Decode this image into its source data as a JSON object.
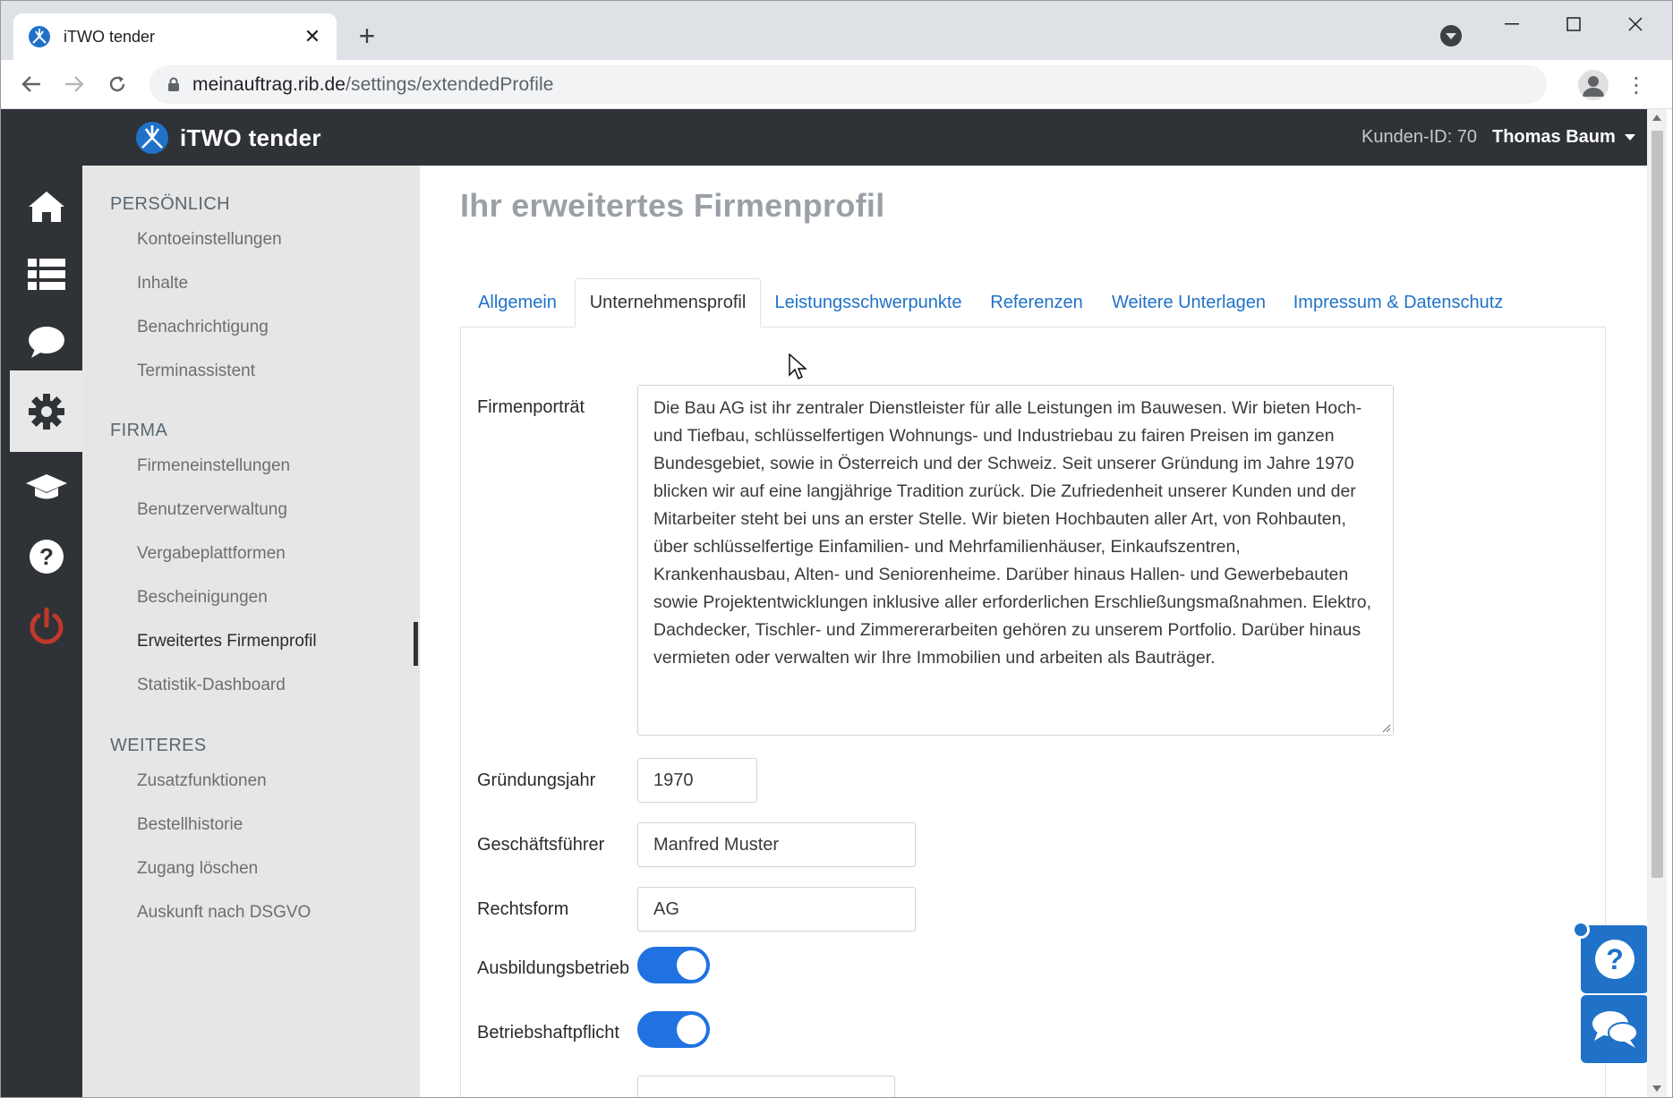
{
  "browser": {
    "tab_title": "iTWO tender",
    "url_host": "meinauftrag.rib.de",
    "url_path": "/settings/extendedProfile"
  },
  "appbar": {
    "logo_text": "iTWO tender",
    "customer_id": "Kunden-ID: 70",
    "user_name": "Thomas Baum"
  },
  "iconrail": [
    {
      "icon": "home-icon"
    },
    {
      "icon": "list-icon"
    },
    {
      "icon": "chat-bubble-icon"
    },
    {
      "icon": "gear-icon",
      "active": true
    },
    {
      "icon": "graduation-cap-icon"
    },
    {
      "icon": "question-circle-icon"
    },
    {
      "icon": "power-icon"
    }
  ],
  "sidenav": {
    "section_personal": "PERSÖNLICH",
    "personal_items": [
      "Kontoeinstellungen",
      "Inhalte",
      "Benachrichtigung",
      "Terminassistent"
    ],
    "section_company": "FIRMA",
    "company_items": [
      "Firmeneinstellungen",
      "Benutzerverwaltung",
      "Vergabeplattformen",
      "Bescheinigungen",
      "Erweitertes Firmenprofil",
      "Statistik-Dashboard"
    ],
    "section_more": "WEITERES",
    "more_items": [
      "Zusatzfunktionen",
      "Bestellhistorie",
      "Zugang löschen",
      "Auskunft nach DSGVO"
    ],
    "active_item": "Erweitertes Firmenprofil"
  },
  "main": {
    "title": "Ihr erweitertes Firmenprofil",
    "tabs": [
      "Allgemein",
      "Unternehmensprofil",
      "Leistungsschwerpunkte",
      "Referenzen",
      "Weitere Unterlagen",
      "Impressum & Datenschutz"
    ],
    "active_tab": "Unternehmensprofil",
    "form": {
      "portrait_label": "Firmenporträt",
      "portrait_value": "Die Bau AG ist ihr zentraler Dienstleister für alle Leistungen im Bauwesen. Wir bieten Hoch- und Tiefbau, schlüsselfertigen Wohnungs- und Industriebau zu fairen Preisen im ganzen Bundesgebiet, sowie in Österreich und der Schweiz. Seit unserer Gründung im Jahre 1970 blicken wir auf eine langjährige Tradition zurück. Die Zufriedenheit unserer Kunden und der Mitarbeiter steht bei uns an erster Stelle. Wir bieten Hochbauten aller Art, von Rohbauten, über schlüsselfertige Einfamilien- und Mehrfamilienhäuser, Einkaufszentren, Krankenhausbau, Alten- und Seniorenheime. Darüber hinaus Hallen- und Gewerbebauten sowie Projektentwicklungen inklusive aller erforderlichen Erschließungsmaßnahmen. Elektro, Dachdecker, Tischler- und Zimmererarbeiten gehören zu unserem Portfolio. Darüber hinaus vermieten oder verwalten wir Ihre Immobilien und arbeiten als Bauträger.",
      "founded_label": "Gründungsjahr",
      "founded_value": "1970",
      "ceo_label": "Geschäftsführer",
      "ceo_value": "Manfred Muster",
      "legal_form_label": "Rechtsform",
      "legal_form_value": "AG",
      "training_label": "Ausbildungsbetrieb",
      "training_on": true,
      "liability_label": "Betriebshaftpflicht",
      "liability_on": true
    }
  },
  "colors": {
    "accent": "#1f72c8",
    "appbar": "#2f3236",
    "sidenav_bg": "#e6e6e6",
    "power": "#c0392b"
  }
}
